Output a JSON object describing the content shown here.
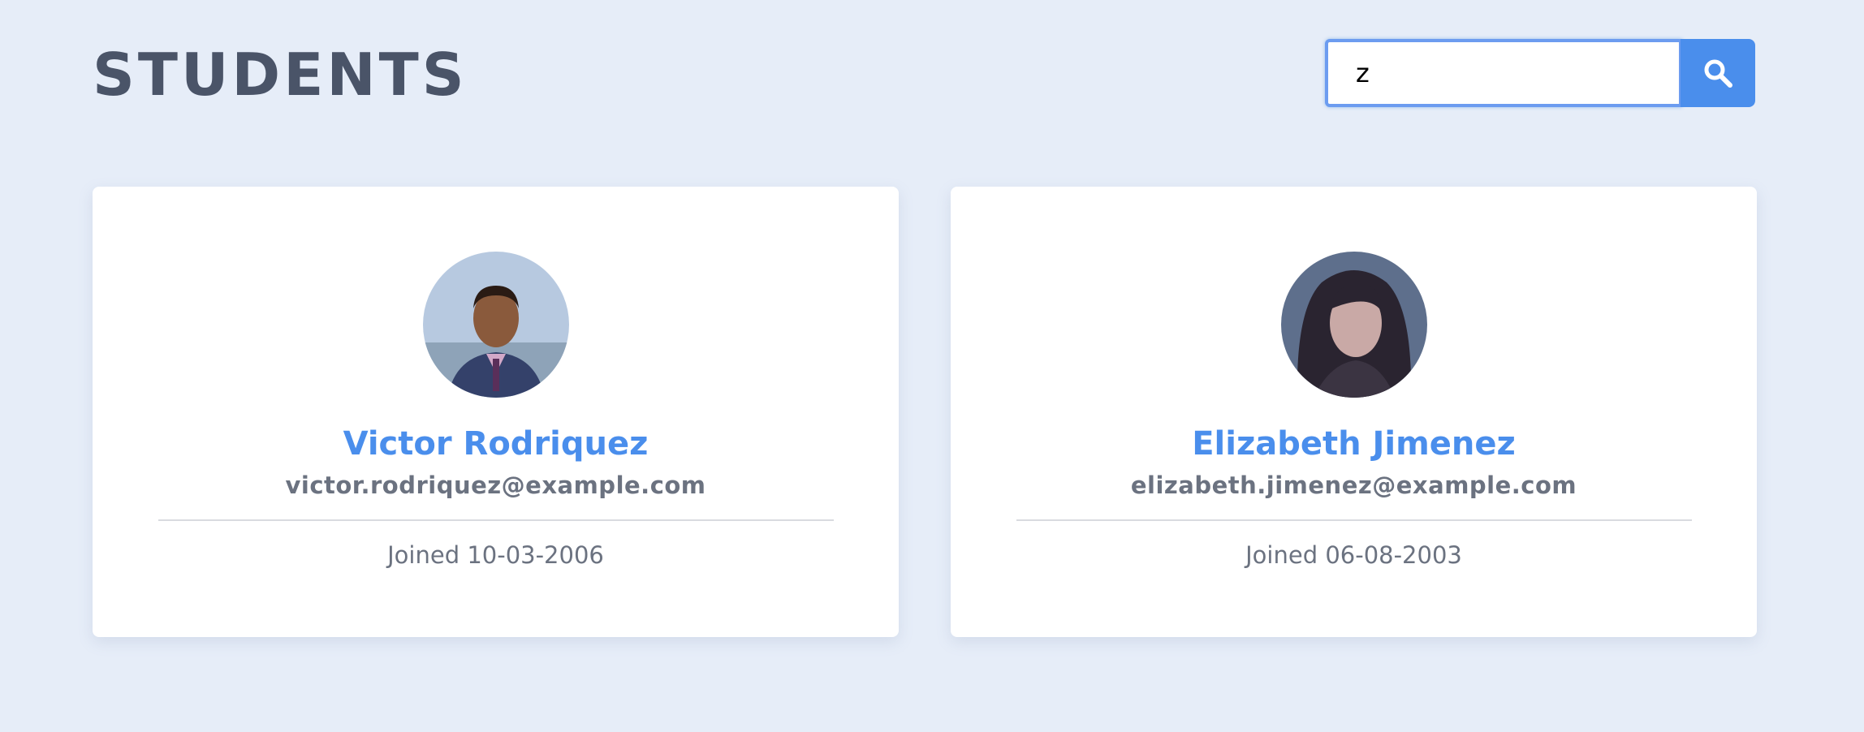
{
  "header": {
    "title": "STUDENTS"
  },
  "search": {
    "value": "z",
    "button_icon": "search-icon",
    "accent_color": "#4a8eec"
  },
  "students": [
    {
      "name": "Victor Rodriquez",
      "email": "victor.rodriquez@example.com",
      "joined": "Joined 10-03-2006"
    },
    {
      "name": "Elizabeth Jimenez",
      "email": "elizabeth.jimenez@example.com",
      "joined": "Joined 06-08-2003"
    }
  ]
}
